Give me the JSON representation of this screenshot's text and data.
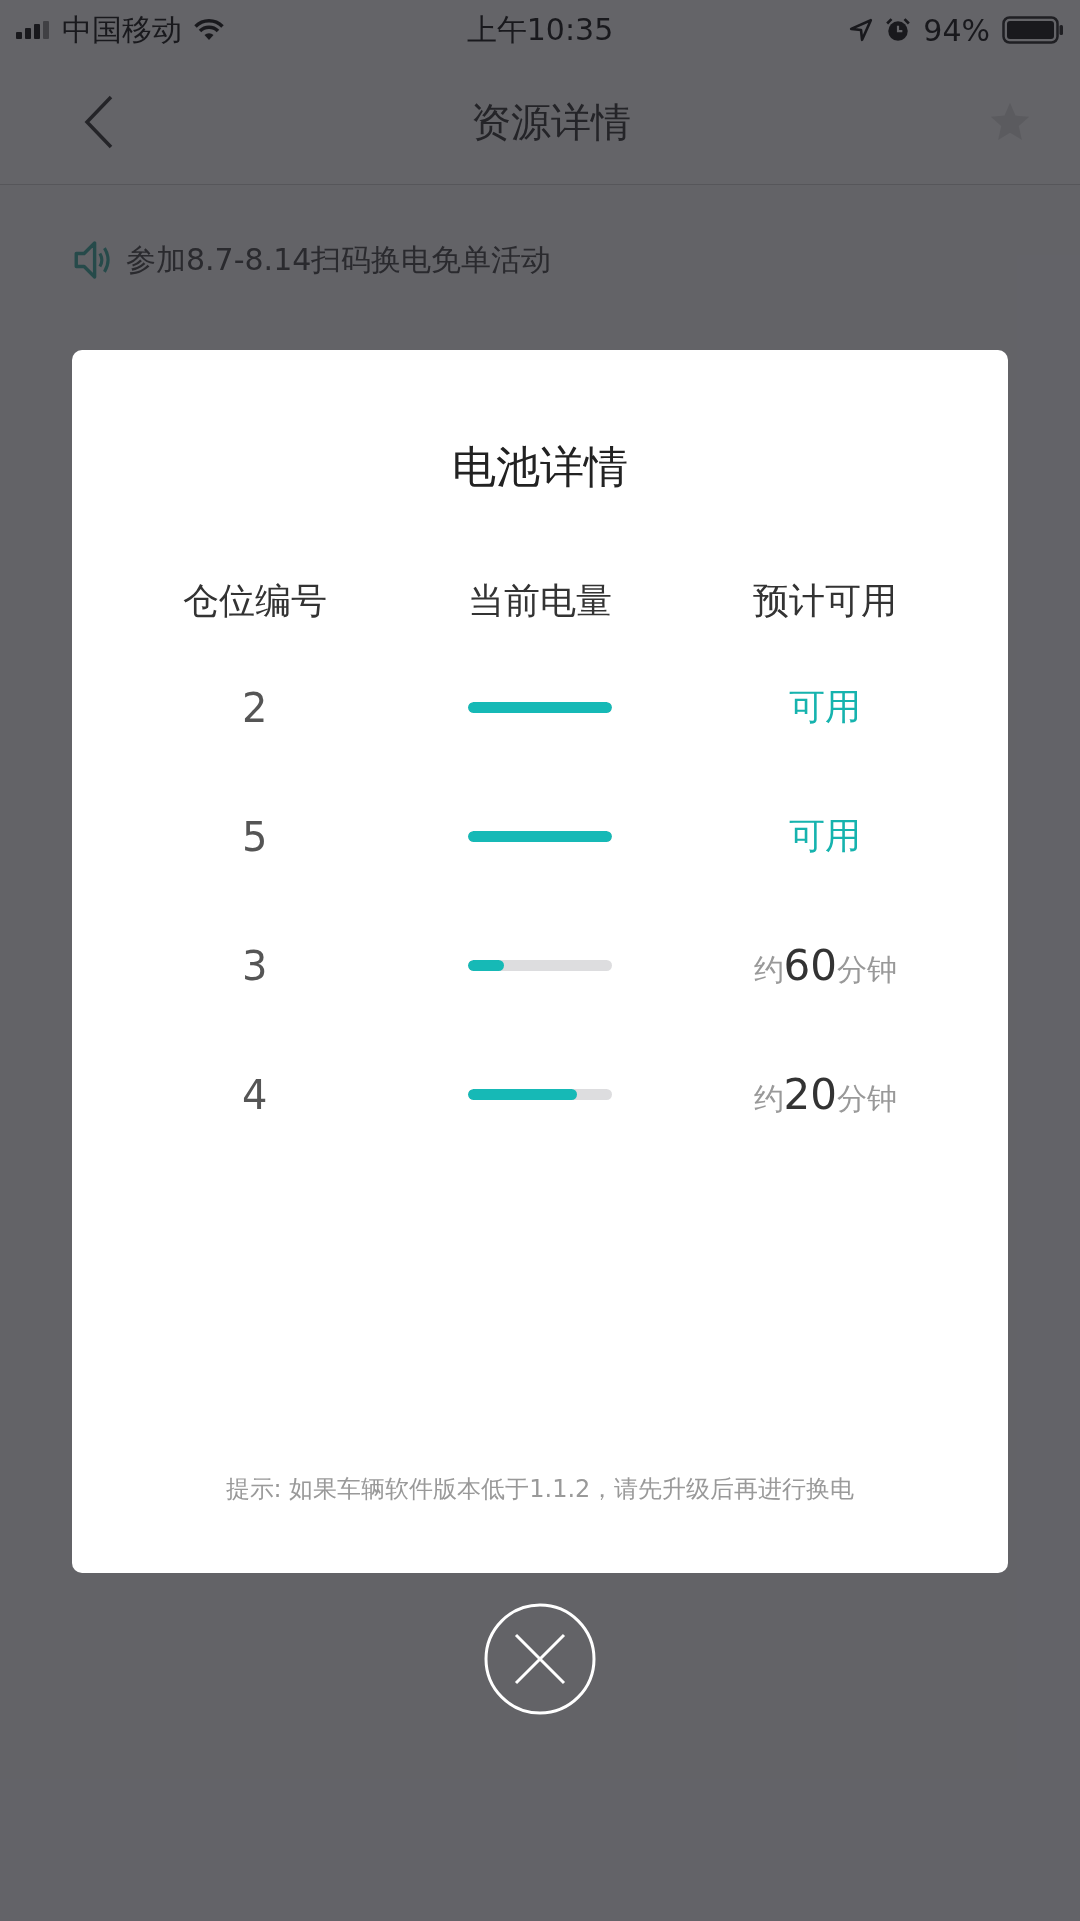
{
  "status_bar": {
    "carrier": "中国移动",
    "time": "上午10:35",
    "battery": "94%"
  },
  "nav": {
    "title": "资源详情"
  },
  "notice": {
    "text": "参加8.7-8.14扫码换电免单活动"
  },
  "dialog": {
    "title": "电池详情",
    "columns": [
      "仓位编号",
      "当前电量",
      "预计可用"
    ],
    "rows": [
      {
        "slot": "2",
        "level": 1.0,
        "kind": "available",
        "status": "可用"
      },
      {
        "slot": "5",
        "level": 1.0,
        "kind": "available",
        "status": "可用"
      },
      {
        "slot": "3",
        "level": 0.25,
        "kind": "estimate",
        "prefix": "约",
        "value": "60",
        "unit": "分钟"
      },
      {
        "slot": "4",
        "level": 0.76,
        "kind": "estimate",
        "prefix": "约",
        "value": "20",
        "unit": "分钟"
      }
    ],
    "hint": "提示: 如果车辆软件版本低于1.1.2，请先升级后再进行换电"
  }
}
